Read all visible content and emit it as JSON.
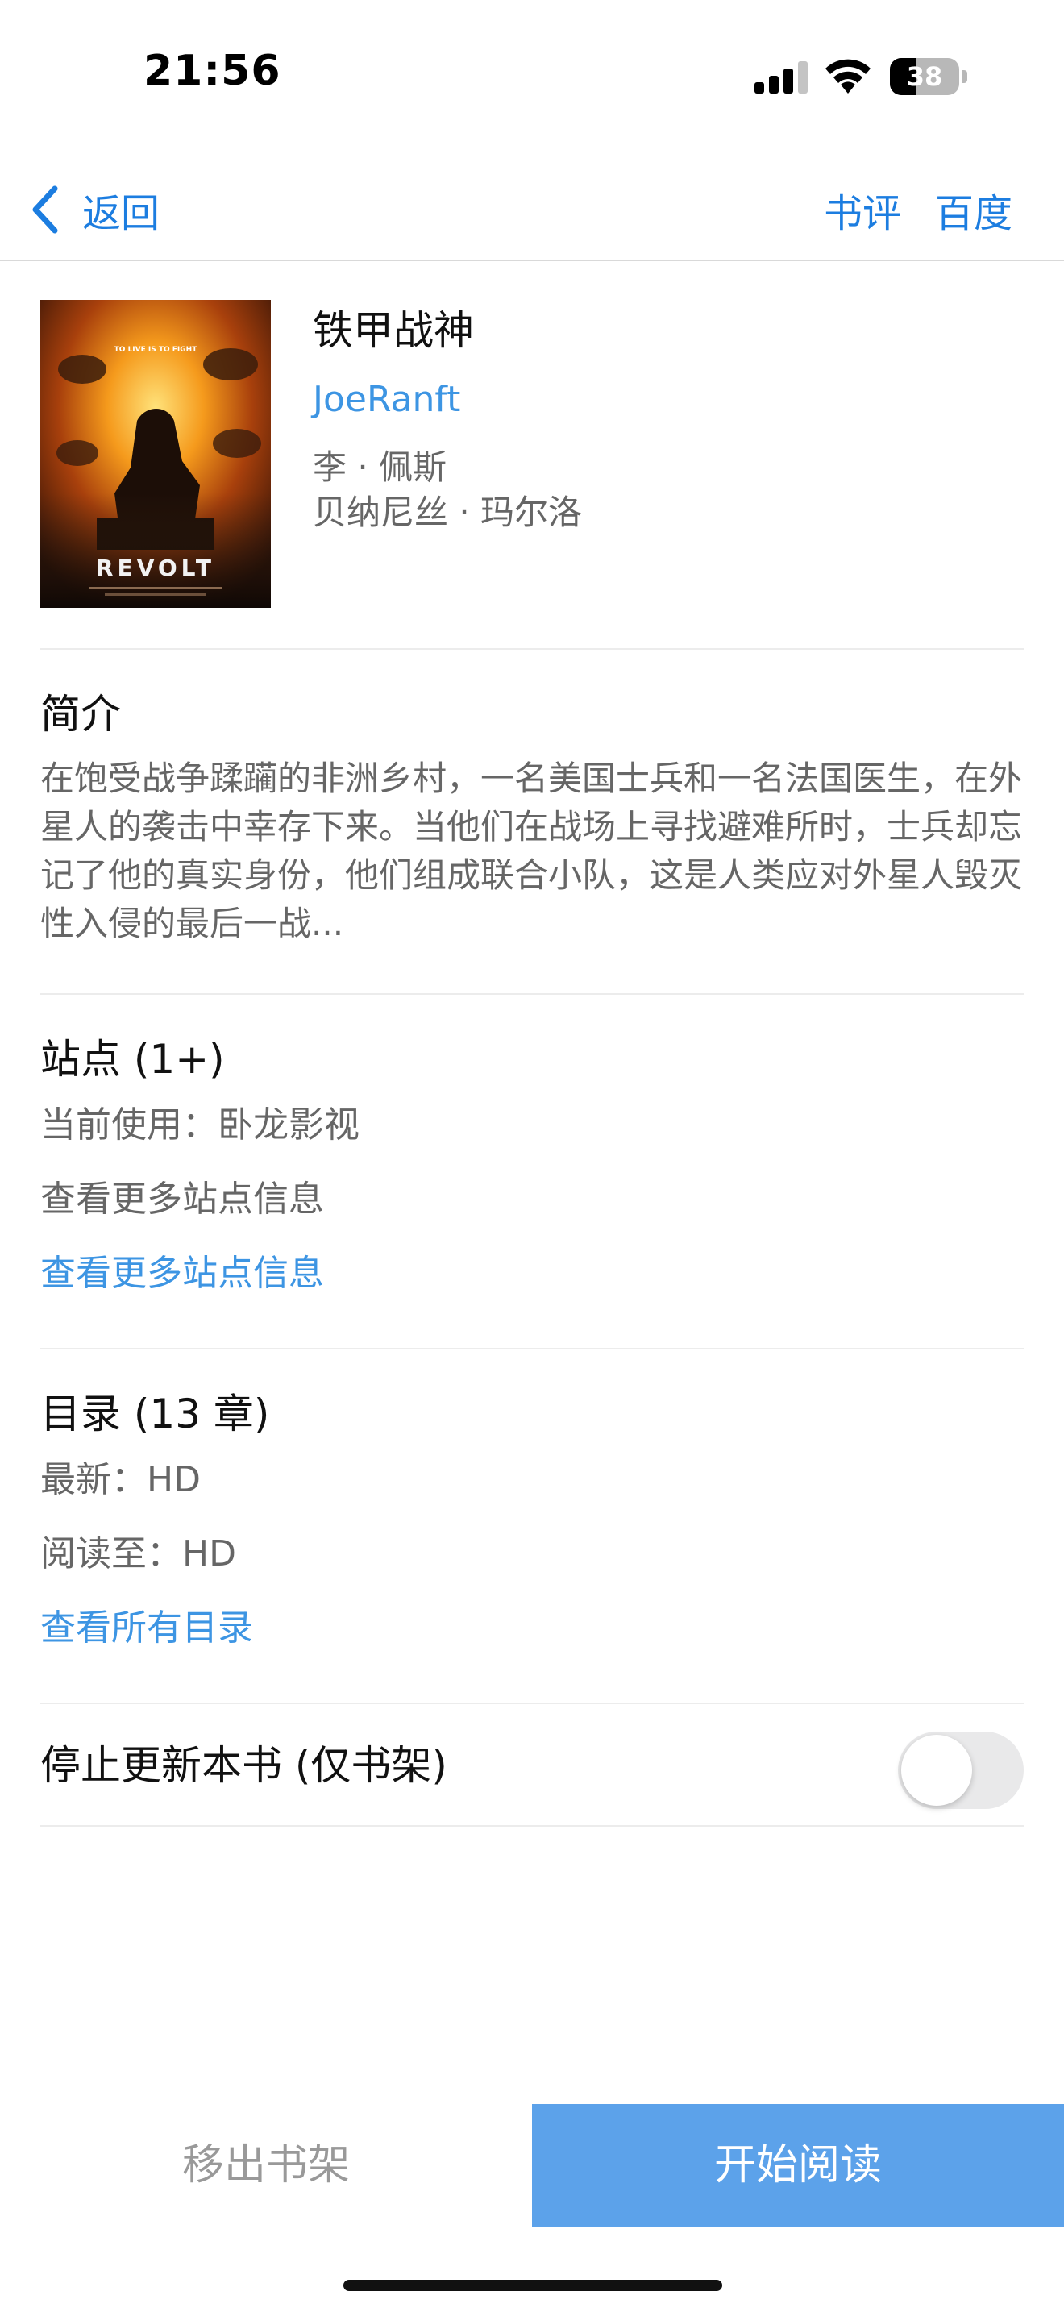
{
  "status": {
    "time": "21:56",
    "battery_level": "38",
    "battery_fraction": 0.38
  },
  "nav": {
    "back_label": "返回",
    "review_label": "书评",
    "baidu_label": "百度"
  },
  "book": {
    "title": "铁甲战神",
    "author": "JoeRanft",
    "cast": [
      "李 · 佩斯",
      "贝纳尼丝 · 玛尔洛"
    ],
    "cover": {
      "tagline": "TO LIVE IS TO FIGHT",
      "logo_text": "REVOLT"
    }
  },
  "intro": {
    "title": "简介",
    "text": "在饱受战争蹂躏的非洲乡村，一名美国士兵和一名法国医生，在外星人的袭击中幸存下来。当他们在战场上寻找避难所时，士兵却忘记了他的真实身份，他们组成联合小队，这是人类应对外星人毁灭性入侵的最后一战..."
  },
  "sites": {
    "title": "站点 (1+)",
    "current": "当前使用：卧龙影视",
    "more_info": "查看更多站点信息",
    "more_link": "查看更多站点信息"
  },
  "toc": {
    "title": "目录 (13 章)",
    "latest": "最新：HD",
    "read_to": "阅读至：HD",
    "all_link": "查看所有目录"
  },
  "stop_update": {
    "label": "停止更新本书 (仅书架)",
    "enabled": false
  },
  "actions": {
    "remove_label": "移出书架",
    "read_label": "开始阅读"
  },
  "colors": {
    "accent": "#1c7de0",
    "link": "#3d95e3",
    "primary_button": "#5ca2ea"
  }
}
